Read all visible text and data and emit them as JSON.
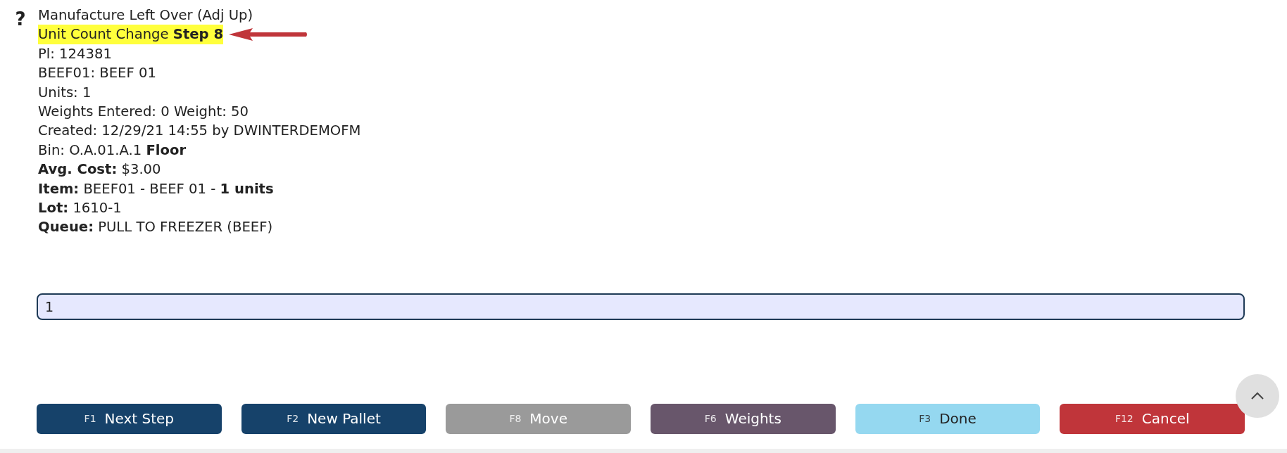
{
  "help_icon": "?",
  "title": "Manufacture Left Over (Adj Up)",
  "step": {
    "text": "Unit Count Change **Step 8**",
    "highlighted": true
  },
  "details": [
    "Pl: 124381",
    "BEEF01: BEEF 01",
    "Units: 1",
    "Weights Entered: 0 Weight: 50",
    "Created: 12/29/21 14:55 by DWINTERDEMOFM",
    "Bin: O.A.01.A.1 **Floor**",
    "**Avg. Cost:** $3.00",
    "**Item:** BEEF01 - BEEF 01 - **1 units**",
    "**Lot:** 1610-1",
    "**Queue:** PULL TO FREEZER (BEEF)"
  ],
  "input": {
    "value": "1"
  },
  "buttons": [
    {
      "key": "F1",
      "label": "Next Step",
      "color": "#16426a"
    },
    {
      "key": "F2",
      "label": "New Pallet",
      "color": "#16426a"
    },
    {
      "key": "F8",
      "label": "Move",
      "color": "#9a9a9a"
    },
    {
      "key": "F6",
      "label": "Weights",
      "color": "#68566b"
    },
    {
      "key": "F3",
      "label": "Done",
      "color": "#95d8f0"
    },
    {
      "key": "F12",
      "label": "Cancel",
      "color": "#c0353a"
    }
  ]
}
